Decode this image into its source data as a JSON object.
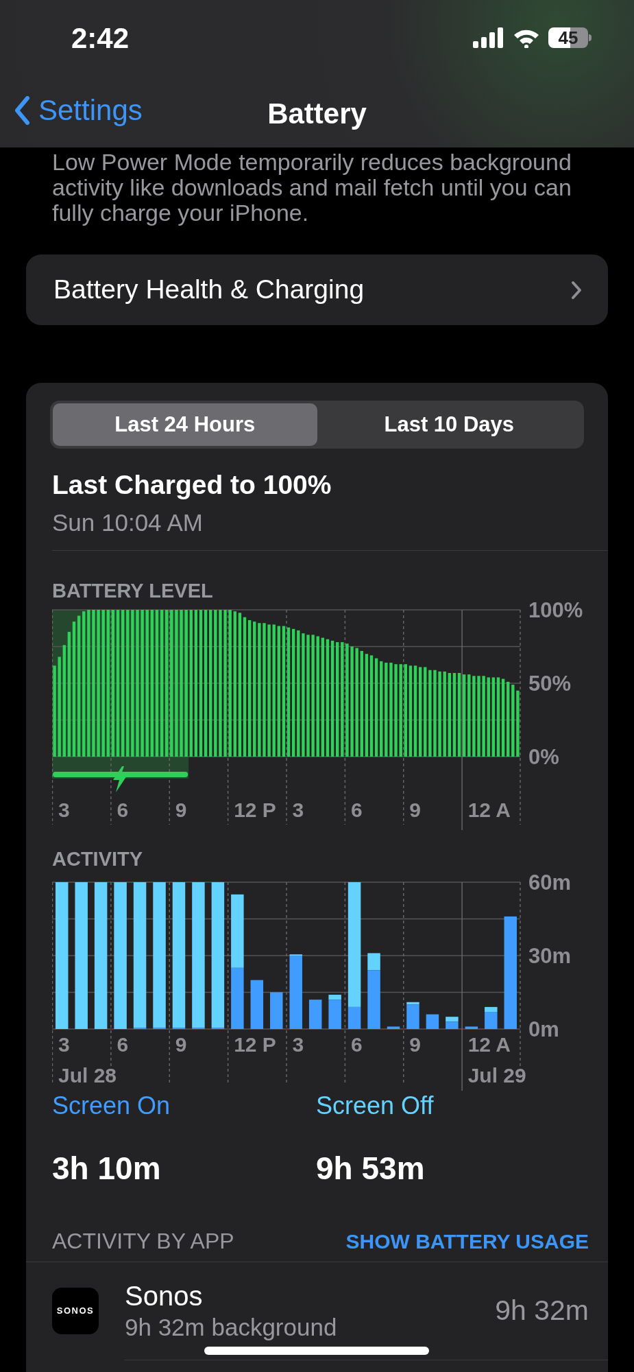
{
  "status_bar": {
    "time": "2:42",
    "battery": "45"
  },
  "nav": {
    "back": "Settings",
    "title": "Battery"
  },
  "low_power_note": "Low Power Mode temporarily reduces background activity like downloads and mail fetch until you can fully charge your iPhone.",
  "health_row": {
    "label": "Battery Health & Charging"
  },
  "usage": {
    "tabs": [
      {
        "label": "Last 24 Hours",
        "selected": true
      },
      {
        "label": "Last 10 Days",
        "selected": false
      }
    ],
    "last_charged": {
      "title": "Last Charged to 100%",
      "time": "Sun 10:04 AM"
    },
    "battery_level": {
      "heading": "BATTERY LEVEL",
      "chart_data": {
        "type": "bar",
        "ylim": [
          0,
          100
        ],
        "values": [
          62,
          68,
          76,
          85,
          92,
          96,
          99,
          100,
          100,
          100,
          100,
          100,
          100,
          100,
          100,
          100,
          100,
          100,
          100,
          100,
          100,
          100,
          100,
          100,
          100,
          100,
          100,
          100,
          100,
          100,
          100,
          100,
          100,
          100,
          100,
          100,
          100,
          99,
          98,
          95,
          93,
          92,
          91,
          91,
          90,
          90,
          89,
          89,
          88,
          87,
          86,
          84,
          83,
          83,
          82,
          81,
          80,
          79,
          78,
          78,
          77,
          75,
          74,
          72,
          70,
          69,
          67,
          65,
          64,
          64,
          63,
          63,
          63,
          62,
          62,
          61,
          61,
          59,
          59,
          58,
          58,
          57,
          57,
          57,
          56,
          56,
          55,
          55,
          55,
          54,
          54,
          54,
          53,
          51,
          49,
          45
        ],
        "yticks": [
          {
            "value": 0,
            "label": "0%"
          },
          {
            "value": 50,
            "label": "50%"
          },
          {
            "value": 100,
            "label": "100%"
          }
        ]
      },
      "time_labels": [
        "3",
        "6",
        "9",
        "12 P",
        "3",
        "6",
        "9",
        "12 A"
      ]
    },
    "activity": {
      "heading": "ACTIVITY",
      "chart_data": {
        "type": "bar",
        "stacked": true,
        "ylim": [
          0,
          60
        ],
        "series": [
          {
            "name": "Screen On",
            "color": "#409cff",
            "values": [
              0,
              0,
              0,
              0,
              0.5,
              0.5,
              0.5,
              0.5,
              0.5,
              25,
              20,
              15,
              30,
              12,
              12,
              9,
              24,
              1,
              10,
              6,
              3,
              1,
              7,
              46
            ]
          },
          {
            "name": "Screen Off",
            "color": "#64d2ff",
            "values": [
              60,
              60,
              60,
              60,
              59.5,
              59.5,
              59.5,
              59.5,
              59.5,
              30,
              0,
              0,
              0.5,
              0,
              2,
              51,
              7,
              0,
              1,
              0,
              2,
              0,
              2,
              0
            ]
          }
        ],
        "yticks": [
          {
            "value": 0,
            "label": "0m"
          },
          {
            "value": 30,
            "label": "30m"
          },
          {
            "value": 60,
            "label": "60m"
          }
        ]
      },
      "time_labels": [
        "3",
        "6",
        "9",
        "12 P",
        "3",
        "6",
        "9",
        "12 A"
      ],
      "dates": [
        "Jul 28",
        "Jul 29"
      ]
    },
    "totals": [
      {
        "value": "3h 10m"
      },
      {
        "value": "9h 53m"
      }
    ],
    "activity_by_app": {
      "heading": "ACTIVITY BY APP",
      "action": "SHOW BATTERY USAGE"
    },
    "apps": [
      {
        "name": "Sonos",
        "icon_text": "SONOS",
        "detail": "9h 32m background",
        "time": "9h 32m"
      }
    ]
  }
}
